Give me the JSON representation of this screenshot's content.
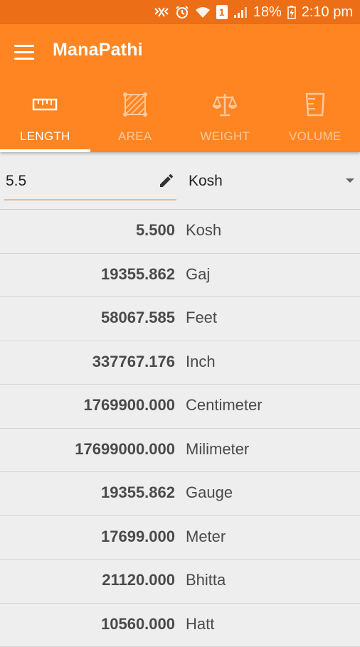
{
  "status_bar": {
    "battery": "18%",
    "time": "2:10 pm",
    "sim": "1"
  },
  "app": {
    "title": "ManaPathi"
  },
  "tabs": [
    {
      "label": "LENGTH",
      "icon": "ruler-icon",
      "active": true
    },
    {
      "label": "AREA",
      "icon": "area-icon",
      "active": false
    },
    {
      "label": "WEIGHT",
      "icon": "scale-icon",
      "active": false
    },
    {
      "label": "VOLUME",
      "icon": "beaker-icon",
      "active": false
    }
  ],
  "converter": {
    "input_value": "5.5",
    "selected_unit": "Kosh"
  },
  "results": [
    {
      "value": "5.500",
      "unit": "Kosh"
    },
    {
      "value": "19355.862",
      "unit": "Gaj"
    },
    {
      "value": "58067.585",
      "unit": "Feet"
    },
    {
      "value": "337767.176",
      "unit": "Inch"
    },
    {
      "value": "1769900.000",
      "unit": "Centimeter"
    },
    {
      "value": "17699000.000",
      "unit": "Milimeter"
    },
    {
      "value": "19355.862",
      "unit": "Gauge"
    },
    {
      "value": "17699.000",
      "unit": "Meter"
    },
    {
      "value": "21120.000",
      "unit": "Bhitta"
    },
    {
      "value": "10560.000",
      "unit": "Hatt"
    }
  ],
  "colors": {
    "app_bar": "#fe8522",
    "status_bar": "#ec6f17",
    "input_underline": "#f7b488"
  }
}
